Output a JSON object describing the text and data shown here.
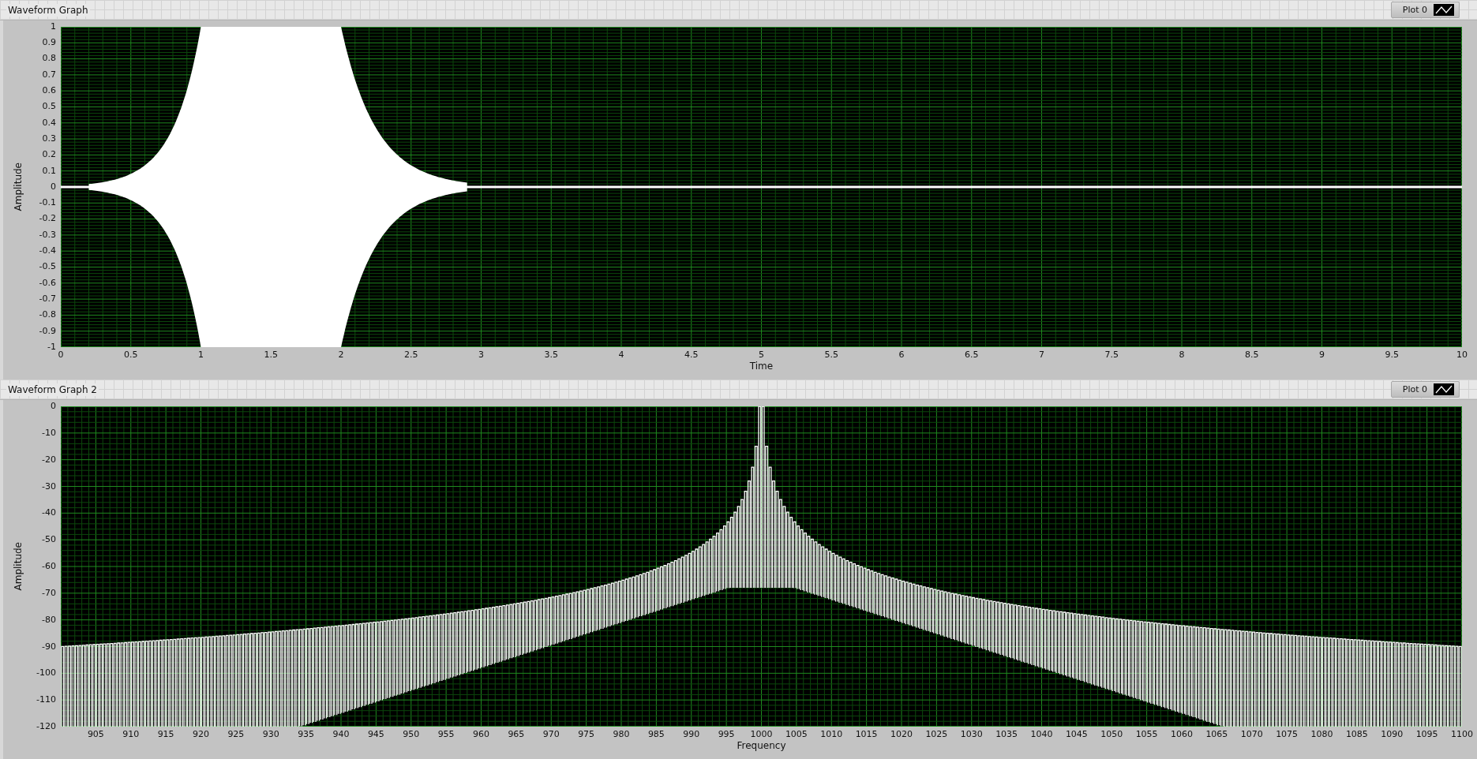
{
  "graphs": [
    {
      "title": "Waveform Graph",
      "kind": "burst",
      "legend": {
        "label": "Plot 0"
      },
      "y_axis": {
        "label": "Amplitude",
        "ticks": [
          "1",
          "0.9",
          "0.8",
          "0.7",
          "0.6",
          "0.5",
          "0.4",
          "0.3",
          "0.2",
          "0.1",
          "0",
          "-0.1",
          "-0.2",
          "-0.3",
          "-0.4",
          "-0.5",
          "-0.6",
          "-0.7",
          "-0.8",
          "-0.9",
          "-1"
        ]
      },
      "x_axis": {
        "label": "Time",
        "first_tick_unlabeled": false,
        "ticks": [
          "0",
          "0.5",
          "1",
          "1.5",
          "2",
          "2.5",
          "3",
          "3.5",
          "4",
          "4.5",
          "5",
          "5.5",
          "6",
          "6.5",
          "7",
          "7.5",
          "8",
          "8.5",
          "9",
          "9.5",
          "10"
        ]
      }
    },
    {
      "title": "Waveform Graph 2",
      "kind": "spectrum",
      "legend": {
        "label": "Plot 0"
      },
      "y_axis": {
        "label": "Amplitude",
        "ticks": [
          "0",
          "-10",
          "-20",
          "-30",
          "-40",
          "-50",
          "-60",
          "-70",
          "-80",
          "-90",
          "-100",
          "-110",
          "-120"
        ]
      },
      "x_axis": {
        "label": "Frequency",
        "first_tick_unlabeled": true,
        "ticks": [
          "905",
          "910",
          "915",
          "920",
          "925",
          "930",
          "935",
          "940",
          "945",
          "950",
          "955",
          "960",
          "965",
          "970",
          "975",
          "980",
          "985",
          "990",
          "995",
          "1000",
          "1005",
          "1010",
          "1015",
          "1020",
          "1025",
          "1030",
          "1035",
          "1040",
          "1045",
          "1050",
          "1055",
          "1060",
          "1065",
          "1070",
          "1075",
          "1080",
          "1085",
          "1090",
          "1095",
          "1100"
        ]
      }
    }
  ]
}
